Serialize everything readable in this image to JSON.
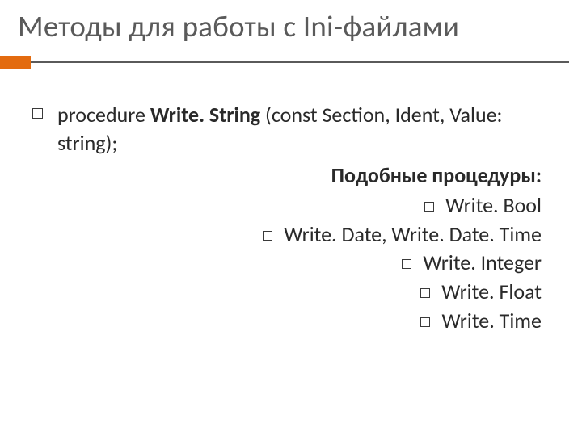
{
  "title": "Методы для работы с Ini-файлами",
  "main": {
    "pre": "procedure ",
    "bold": "Write. String",
    "post": " (const Section, Ident, Value: string);"
  },
  "sublist": {
    "heading": "Подобные процедуры:",
    "items": [
      "Write. Bool",
      "Write. Date, Write. Date. Time",
      "Write. Integer",
      "Write. Float",
      "Write. Time"
    ]
  }
}
